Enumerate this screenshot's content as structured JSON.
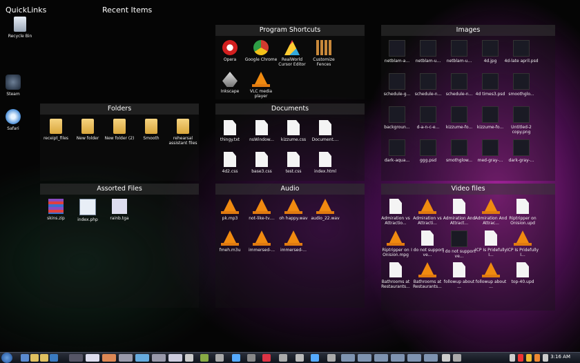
{
  "headers": {
    "quicklinks": "QuickLinks",
    "recent": "Recent Items"
  },
  "quicklinks": [
    {
      "label": "Recycle Bin",
      "icon": "recycle-bin-icon"
    },
    {
      "label": "Steam",
      "icon": "steam-icon"
    },
    {
      "label": "Safari",
      "icon": "safari-icon"
    }
  ],
  "program_shortcuts": {
    "title": "Program Shortcuts",
    "items": [
      {
        "label": "Opera",
        "icon": "opera-icon"
      },
      {
        "label": "Google Chrome",
        "icon": "chrome-icon"
      },
      {
        "label": "RealWorld Cursor Editor",
        "icon": "realworld-icon"
      },
      {
        "label": "Customize Fences",
        "icon": "fences-icon"
      },
      {
        "label": "Inkscape",
        "icon": "inkscape-icon"
      },
      {
        "label": "VLC media player",
        "icon": "vlc-icon"
      }
    ]
  },
  "images": {
    "title": "Images",
    "items": [
      {
        "label": "netblam-a..."
      },
      {
        "label": "netblam-u..."
      },
      {
        "label": "netblam-u..."
      },
      {
        "label": "4d.jpg"
      },
      {
        "label": "4d-late april.psd"
      },
      {
        "label": "schedule-g..."
      },
      {
        "label": "schedule-n..."
      },
      {
        "label": "schedule-n..."
      },
      {
        "label": "4d times3.psd"
      },
      {
        "label": "smoothglo..."
      },
      {
        "label": "backgroun..."
      },
      {
        "label": "d-a-n-c-e..."
      },
      {
        "label": "kizzume-fo..."
      },
      {
        "label": "kizzume-fo..."
      },
      {
        "label": "Untitled-2 copy.png"
      },
      {
        "label": "dark-aqua..."
      },
      {
        "label": "ggg.psd"
      },
      {
        "label": "smothglow..."
      },
      {
        "label": "med-gray-..."
      },
      {
        "label": "dark-gray-..."
      }
    ]
  },
  "folders": {
    "title": "Folders",
    "items": [
      {
        "label": "receipt_files"
      },
      {
        "label": "New folder"
      },
      {
        "label": "New folder (2)"
      },
      {
        "label": "Smooth"
      },
      {
        "label": "rehearsal assistant files"
      }
    ]
  },
  "documents": {
    "title": "Documents",
    "items": [
      {
        "label": "thingy.txt"
      },
      {
        "label": "nsWindow..."
      },
      {
        "label": "kizzume.css"
      },
      {
        "label": "Document...."
      },
      {
        "label": "4d2.css"
      },
      {
        "label": "base3.css"
      },
      {
        "label": "test.css"
      },
      {
        "label": "index.html"
      }
    ]
  },
  "assorted": {
    "title": "Assorted Files",
    "items": [
      {
        "label": "skins.zip"
      },
      {
        "label": "index.php"
      },
      {
        "label": "rainb.tga"
      }
    ]
  },
  "audio": {
    "title": "Audio",
    "items": [
      {
        "label": "pk.mp3"
      },
      {
        "label": "not-like-tv...."
      },
      {
        "label": "oh happy.wav"
      },
      {
        "label": "audio_22.wav"
      },
      {
        "label": "fmeh.m3u"
      },
      {
        "label": "immersed-..."
      },
      {
        "label": "immersed-..."
      }
    ]
  },
  "video": {
    "title": "Video files",
    "items": [
      {
        "label": "Admiration vs Attractio...",
        "kind": "doc"
      },
      {
        "label": "Admiration vs Attracti...",
        "kind": "cone"
      },
      {
        "label": "Admiration And Attract...",
        "kind": "doc"
      },
      {
        "label": "Admiration And Attrac...",
        "kind": "cone"
      },
      {
        "label": "Riptripper on Onision.upd",
        "kind": "doc"
      },
      {
        "label": "Riptripper on Onision.mpg",
        "kind": "cone"
      },
      {
        "label": "I do not support ve...",
        "kind": "doc"
      },
      {
        "label": "I do not support ve...",
        "kind": "thumb"
      },
      {
        "label": "ICP Is Pridefully I...",
        "kind": "doc"
      },
      {
        "label": "ICP Is Pridefully I...",
        "kind": "cone"
      },
      {
        "label": "Bathrooms at Restaurants...",
        "kind": "doc"
      },
      {
        "label": "Bathrooms at Restaurants...",
        "kind": "cone"
      },
      {
        "label": "followup about ...",
        "kind": "doc"
      },
      {
        "label": "followup about ...",
        "kind": "cone"
      },
      {
        "label": "top-40.upd",
        "kind": "doc"
      }
    ]
  },
  "taskbar": {
    "clock": "3:16 AM"
  }
}
